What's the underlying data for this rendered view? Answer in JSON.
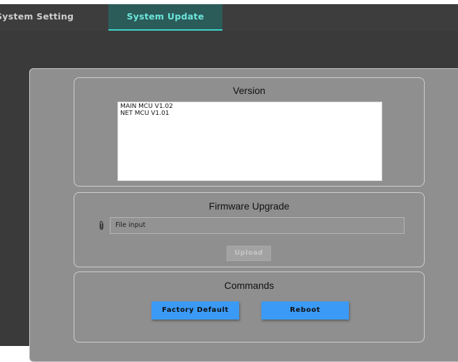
{
  "tabs": [
    {
      "label": "System Setting",
      "active": false
    },
    {
      "label": "System Update",
      "active": true
    }
  ],
  "version": {
    "title": "Version",
    "lines": [
      "MAIN MCU V1.02",
      "NET MCU V1.01"
    ]
  },
  "firmware": {
    "title": "Firmware Upgrade",
    "file_input_placeholder": "File input",
    "upload_label": "Upload",
    "attach_icon": "paperclip-icon"
  },
  "commands": {
    "title": "Commands",
    "factory_default_label": "Factory Default",
    "reboot_label": "Reboot"
  },
  "colors": {
    "accent_tab_text": "#6ee6dc",
    "accent_tab_bg": "#2b5c5a",
    "button_blue": "#3b9af5",
    "panel_gray": "#8f8f8f"
  }
}
